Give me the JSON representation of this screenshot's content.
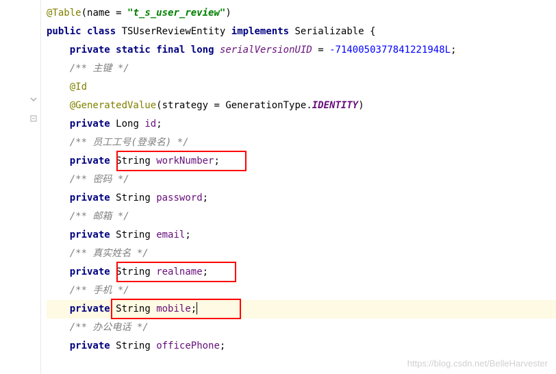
{
  "annotation_table": "@Table",
  "annotation_table_attr": "name",
  "table_name": "\"t_s_user_review\"",
  "kw_public": "public",
  "kw_class": "class",
  "classname": "TSUserReviewEntity",
  "kw_implements": "implements",
  "iface": "Serializable",
  "kw_private": "private",
  "kw_static": "static",
  "kw_final": "final",
  "kw_long": "long",
  "svu": "serialVersionUID",
  "svu_val": "-7140050377841221948L",
  "comment_pk": "/** 主键 */",
  "annotation_id": "@Id",
  "annotation_gen": "@GeneratedValue",
  "gen_attr": "strategy",
  "gen_type_class": "GenerationType",
  "gen_identity": "IDENTITY",
  "type_long": "Long",
  "type_string": "String",
  "field_id": "id",
  "comment_worknum": "/** 员工工号(登录名) */",
  "field_worknum": "workNumber",
  "comment_password": "/** 密码 */",
  "field_password": "password",
  "comment_email": "/** 邮箱 */",
  "field_email": "email",
  "comment_realname": "/** 真实姓名 */",
  "field_realname": "realname",
  "comment_mobile": "/** 手机 */",
  "field_mobile": "mobile",
  "comment_office": "/** 办公电话 */",
  "field_office": "officePhone",
  "watermark": "https://blog.csdn.net/BelleHarvester"
}
